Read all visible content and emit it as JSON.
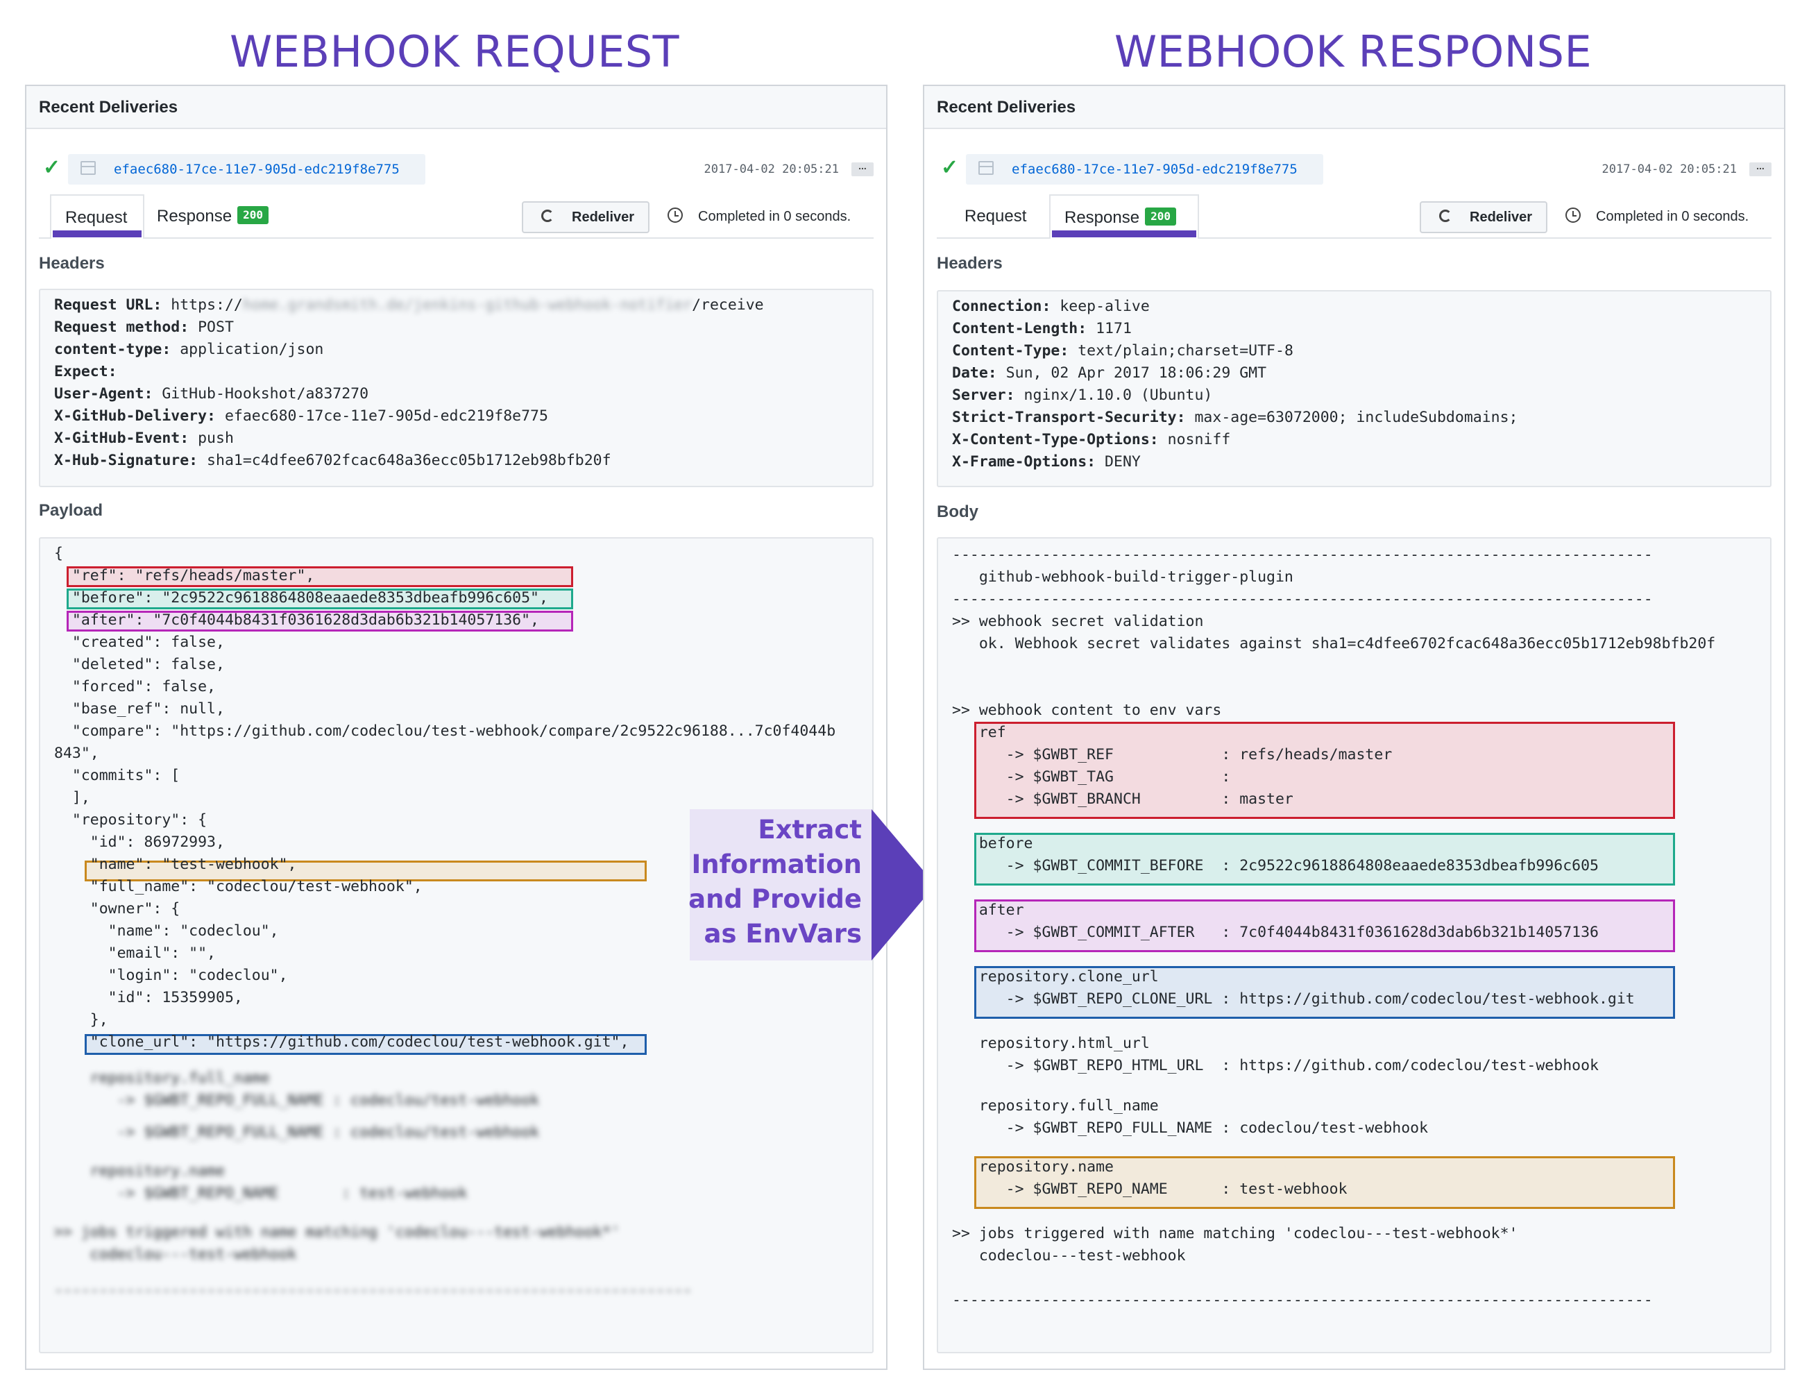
{
  "titles": {
    "request": "WEBHOOK REQUEST",
    "response": "WEBHOOK RESPONSE"
  },
  "colors": {
    "accent": "#5b3fb8",
    "success": "#28a745",
    "highlight_ref": "#cc1f2f",
    "highlight_before": "#1fa98c",
    "highlight_after": "#b526b8",
    "highlight_name": "#c9891e",
    "highlight_clone_url": "#1f5fab"
  },
  "request_panel": {
    "header": "Recent Deliveries",
    "status_icon": "check-icon",
    "delivery_guid": "efaec680-17ce-11e7-905d-edc219f8e775",
    "datetime": "2017-04-02 20:05:21",
    "more_label": "...",
    "tab_request": "Request",
    "tab_response": "Response",
    "response_badge": "200",
    "active_tab": "Request",
    "redeliver_label": "Redeliver",
    "completed_text": "Completed in 0 seconds.",
    "headers_label": "Headers",
    "payload_label": "Payload",
    "headers": [
      {
        "key": "Request URL:",
        "value": " https://",
        "blurred": "home.grandsmith.de/jenkins-github-webhook-notifier",
        "suffix": "/receive"
      },
      {
        "key": "Request method:",
        "value": " POST"
      },
      {
        "key": "content-type:",
        "value": " application/json"
      },
      {
        "key": "Expect:",
        "value": ""
      },
      {
        "key": "User-Agent:",
        "value": " GitHub-Hookshot/a837270"
      },
      {
        "key": "X-GitHub-Delivery:",
        "value": " efaec680-17ce-11e7-905d-edc219f8e775"
      },
      {
        "key": "X-GitHub-Event:",
        "value": " push"
      },
      {
        "key": "X-Hub-Signature:",
        "value": " sha1=c4dfee6702fcac648a36ecc05b1712eb98bfb20f"
      }
    ],
    "payload_lines": [
      "{",
      "  \"ref\": \"refs/heads/master\",",
      "  \"before\": \"2c9522c9618864808eaaede8353dbeafb996c605\",",
      "  \"after\": \"7c0f4044b8431f0361628d3dab6b321b14057136\",",
      "  \"created\": false,",
      "  \"deleted\": false,",
      "  \"forced\": false,",
      "  \"base_ref\": null,",
      "  \"compare\": \"https://github.com/codeclou/test-webhook/compare/2c9522c96188...7c0f4044b",
      "843\",",
      "  \"commits\": [",
      "  ],",
      "  \"repository\": {",
      "    \"id\": 86972993,",
      "    \"name\": \"test-webhook\",",
      "    \"full_name\": \"codeclou/test-webhook\",",
      "    \"owner\": {",
      "      \"name\": \"codeclou\",",
      "      \"email\": \"\",",
      "      \"login\": \"codeclou\",",
      "      \"id\": 15359905,",
      "    },",
      "    \"clone_url\": \"https://github.com/codeclou/test-webhook.git\","
    ],
    "payload_blurred_lines": [
      "    repository.full_name",
      "       -> $GWBT_REPO_FULL_NAME : codeclou/test-webhook",
      "       -> $GWBT_REPO_FULL_NAME : codeclou/test-webhook",
      "    repository.name",
      "       -> $GWBT_REPO_NAME       : test-webhook",
      ">> jobs triggered with name matching 'codeclou---test-webhook*'",
      "    codeclou---test-webhook",
      "-----------------------------------------------------------------------"
    ]
  },
  "response_panel": {
    "header": "Recent Deliveries",
    "status_icon": "check-icon",
    "delivery_guid": "efaec680-17ce-11e7-905d-edc219f8e775",
    "datetime": "2017-04-02 20:05:21",
    "more_label": "...",
    "tab_request": "Request",
    "tab_response": "Response",
    "response_badge": "200",
    "active_tab": "Response",
    "redeliver_label": "Redeliver",
    "completed_text": "Completed in 0 seconds.",
    "headers_label": "Headers",
    "body_label": "Body",
    "headers": [
      {
        "key": "Connection:",
        "value": " keep-alive"
      },
      {
        "key": "Content-Length:",
        "value": " 1171"
      },
      {
        "key": "Content-Type:",
        "value": " text/plain;charset=UTF-8"
      },
      {
        "key": "Date:",
        "value": " Sun, 02 Apr 2017 18:06:29 GMT"
      },
      {
        "key": "Server:",
        "value": " nginx/1.10.0 (Ubuntu)"
      },
      {
        "key": "Strict-Transport-Security:",
        "value": " max-age=63072000; includeSubdomains;"
      },
      {
        "key": "X-Content-Type-Options:",
        "value": " nosniff"
      },
      {
        "key": "X-Frame-Options:",
        "value": " DENY"
      }
    ],
    "body_lines": [
      "------------------------------------------------------------------------------",
      "   github-webhook-build-trigger-plugin",
      "------------------------------------------------------------------------------",
      ">> webhook secret validation",
      "   ok. Webhook secret validates against sha1=c4dfee6702fcac648a36ecc05b1712eb98bfb20f",
      "",
      "",
      ">> webhook content to env vars",
      "   ref",
      "      -> $GWBT_REF            : refs/heads/master",
      "      -> $GWBT_TAG            :",
      "      -> $GWBT_BRANCH         : master",
      "   before",
      "      -> $GWBT_COMMIT_BEFORE  : 2c9522c9618864808eaaede8353dbeafb996c605",
      "   after",
      "      -> $GWBT_COMMIT_AFTER   : 7c0f4044b8431f0361628d3dab6b321b14057136",
      "   repository.clone_url",
      "      -> $GWBT_REPO_CLONE_URL : https://github.com/codeclou/test-webhook.git",
      "   repository.html_url",
      "      -> $GWBT_REPO_HTML_URL  : https://github.com/codeclou/test-webhook",
      "   repository.full_name",
      "      -> $GWBT_REPO_FULL_NAME : codeclou/test-webhook",
      "   repository.name",
      "      -> $GWBT_REPO_NAME      : test-webhook",
      ">> jobs triggered with name matching 'codeclou---test-webhook*'",
      "   codeclou---test-webhook",
      "------------------------------------------------------------------------------"
    ]
  },
  "arrow": {
    "lines": [
      "Extract",
      "Information",
      "and Provide",
      "as EnvVars"
    ]
  }
}
